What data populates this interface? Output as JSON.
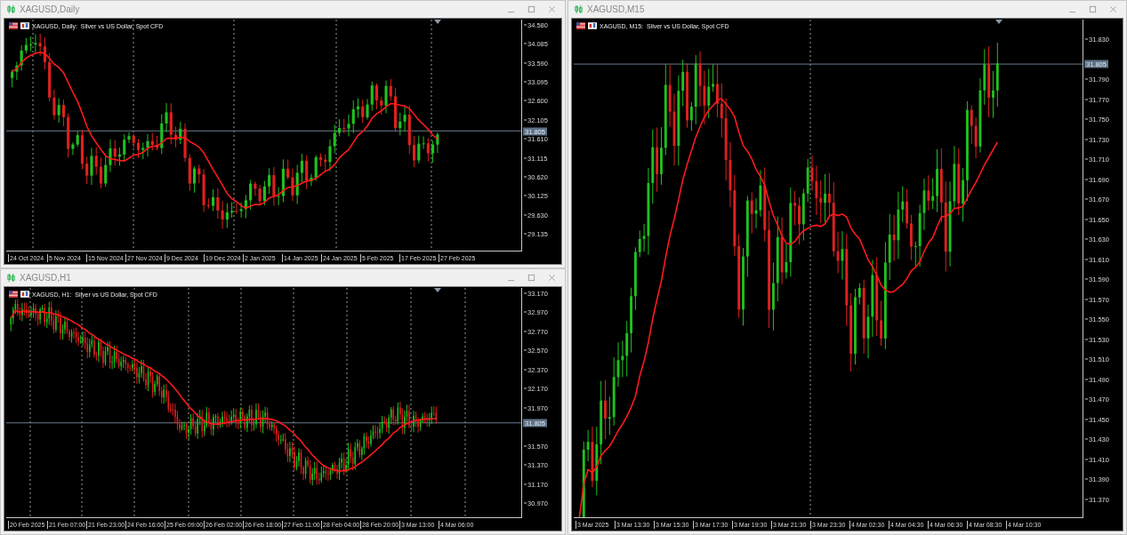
{
  "windows": [
    {
      "title": "XAGUSD,Daily",
      "legend": "XAGUSD, Daily:  Silver vs US Dollar, Spot CFD",
      "price_ticks": [
        "34.580",
        "34.085",
        "33.590",
        "33.095",
        "32.600",
        "32.105",
        "31.610",
        "31.115",
        "30.620",
        "30.125",
        "29.630",
        "29.135"
      ],
      "current_price": "31.805",
      "time_labels": [
        "24 Oct 2024",
        "5 Nov 2024",
        "15 Nov 2024",
        "27 Nov 2024",
        "9 Dec 2024",
        "19 Dec 2024",
        "2 Jan 2025",
        "14 Jan 2025",
        "24 Jan 2025",
        "5 Feb 2025",
        "17 Feb 2025",
        "27 Feb 2025"
      ]
    },
    {
      "title": "XAGUSD,H1",
      "legend": "XAGUSD, H1:  Silver vs US Dollar, Spot CFD",
      "price_ticks": [
        "33.170",
        "32.970",
        "32.770",
        "32.570",
        "32.370",
        "32.170",
        "31.970",
        "31.570",
        "31.370",
        "31.170",
        "30.970"
      ],
      "current_price": "31.805",
      "time_labels": [
        "20 Feb 2025",
        "21 Feb 07:00",
        "21 Feb 23:00",
        "24 Feb 16:00",
        "25 Feb 09:00",
        "26 Feb 02:00",
        "26 Feb 18:00",
        "27 Feb 11:00",
        "28 Feb 04:00",
        "28 Feb 20:00",
        "3 Mar 13:00",
        "4 Mar 06:00"
      ]
    },
    {
      "title": "XAGUSD,M15",
      "legend": "XAGUSD, M15:  Silver vs US Dollar, Spot CFD",
      "price_ticks": [
        "31.830",
        "31.790",
        "31.770",
        "31.750",
        "31.730",
        "31.710",
        "31.690",
        "31.670",
        "31.650",
        "31.630",
        "31.610",
        "31.590",
        "31.570",
        "31.550",
        "31.530",
        "31.510",
        "31.490",
        "31.470",
        "31.450",
        "31.430",
        "31.410",
        "31.390",
        "31.370"
      ],
      "current_price": "31.805",
      "time_labels": [
        "3 Mar 2025",
        "3 Mar 13:30",
        "3 Mar 15:30",
        "3 Mar 17:30",
        "3 Mar 19:30",
        "3 Mar 21:30",
        "3 Mar 23:30",
        "4 Mar 02:30",
        "4 Mar 04:30",
        "4 Mar 06:30",
        "4 Mar 08:30",
        "4 Mar 10:30"
      ]
    }
  ]
}
